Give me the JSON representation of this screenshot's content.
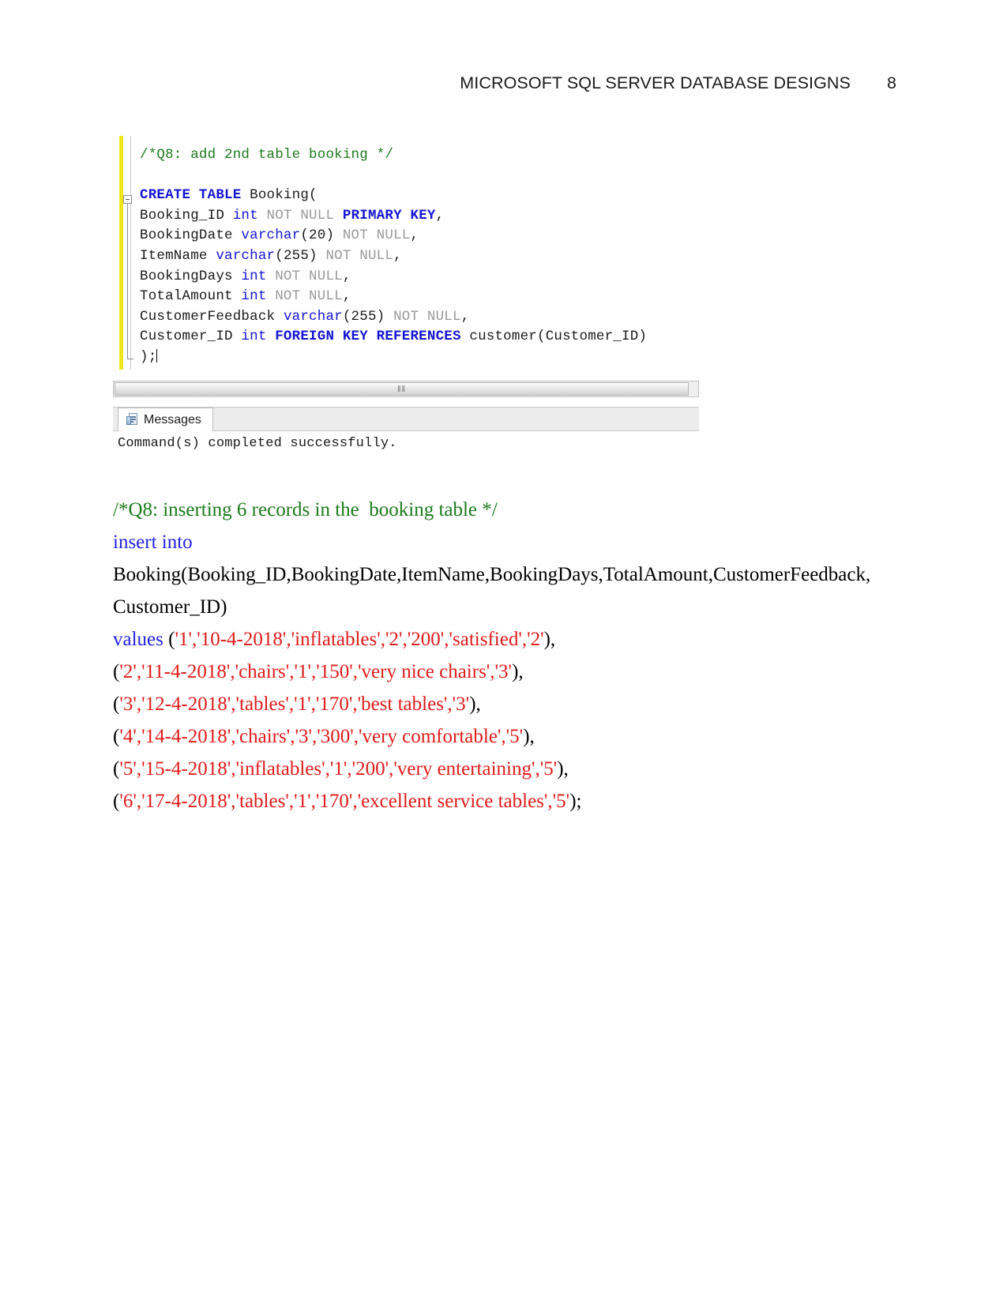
{
  "header": {
    "title": "MICROSOFT SQL SERVER DATABASE DESIGNS",
    "page_number": "8"
  },
  "ssms": {
    "editor": {
      "lines": [
        {
          "id": "l1",
          "segments": [
            {
              "text": "/*Q8: add 2nd table booking */",
              "style": "cmt"
            }
          ]
        },
        {
          "id": "l2",
          "segments": [
            {
              "text": "",
              "style": "pln"
            }
          ]
        },
        {
          "id": "l3",
          "segments": [
            {
              "text": "CREATE TABLE ",
              "style": "kw"
            },
            {
              "text": "Booking(",
              "style": "pln"
            }
          ]
        },
        {
          "id": "l4",
          "segments": [
            {
              "text": "Booking_ID ",
              "style": "pln"
            },
            {
              "text": "int ",
              "style": "typ"
            },
            {
              "text": "NOT NULL ",
              "style": "dim"
            },
            {
              "text": "PRIMARY KEY",
              "style": "kw"
            },
            {
              "text": ",",
              "style": "pln"
            }
          ]
        },
        {
          "id": "l5",
          "segments": [
            {
              "text": "BookingDate ",
              "style": "pln"
            },
            {
              "text": "varchar",
              "style": "typ"
            },
            {
              "text": "(20) ",
              "style": "pln"
            },
            {
              "text": "NOT NULL",
              "style": "dim"
            },
            {
              "text": ",",
              "style": "pln"
            }
          ]
        },
        {
          "id": "l6",
          "segments": [
            {
              "text": "ItemName ",
              "style": "pln"
            },
            {
              "text": "varchar",
              "style": "typ"
            },
            {
              "text": "(255) ",
              "style": "pln"
            },
            {
              "text": "NOT NULL",
              "style": "dim"
            },
            {
              "text": ",",
              "style": "pln"
            }
          ]
        },
        {
          "id": "l7",
          "segments": [
            {
              "text": "BookingDays ",
              "style": "pln"
            },
            {
              "text": "int ",
              "style": "typ"
            },
            {
              "text": "NOT NULL",
              "style": "dim"
            },
            {
              "text": ",",
              "style": "pln"
            }
          ]
        },
        {
          "id": "l8",
          "segments": [
            {
              "text": "TotalAmount ",
              "style": "pln"
            },
            {
              "text": "int ",
              "style": "typ"
            },
            {
              "text": "NOT NULL",
              "style": "dim"
            },
            {
              "text": ",",
              "style": "pln"
            }
          ]
        },
        {
          "id": "l9",
          "segments": [
            {
              "text": "CustomerFeedback ",
              "style": "pln"
            },
            {
              "text": "varchar",
              "style": "typ"
            },
            {
              "text": "(255) ",
              "style": "pln"
            },
            {
              "text": "NOT NULL",
              "style": "dim"
            },
            {
              "text": ",",
              "style": "pln"
            }
          ]
        },
        {
          "id": "l10",
          "segments": [
            {
              "text": "Customer_ID ",
              "style": "pln"
            },
            {
              "text": "int ",
              "style": "typ"
            },
            {
              "text": "FOREIGN KEY REFERENCES ",
              "style": "kw"
            },
            {
              "text": "customer(Customer_ID)",
              "style": "pln"
            }
          ]
        },
        {
          "id": "l11",
          "segments": [
            {
              "text": ");",
              "style": "pln"
            }
          ],
          "caret": true
        }
      ]
    },
    "scrollbar": {
      "grip": "‖‖"
    },
    "results_tab": {
      "icon": "messages-icon",
      "label": "Messages"
    },
    "results_message": "Command(s) completed successfully."
  },
  "document": {
    "lines": [
      {
        "id": "d1",
        "parts": [
          {
            "text": "/*Q8: inserting 6 records in the  booking table */",
            "color": "t-green"
          }
        ]
      },
      {
        "id": "d2",
        "parts": [
          {
            "text": "insert into",
            "color": "t-blue"
          }
        ]
      },
      {
        "id": "d3",
        "parts": [
          {
            "text": "Booking(Booking_ID,BookingDate,ItemName,BookingDays,TotalAmount,CustomerFeedback,",
            "color": "t-black"
          }
        ]
      },
      {
        "id": "d4",
        "parts": [
          {
            "text": "Customer_ID)",
            "color": "t-black"
          }
        ]
      },
      {
        "id": "d5",
        "parts": [
          {
            "text": "values ",
            "color": "t-blue"
          },
          {
            "text": "(",
            "color": "t-black"
          },
          {
            "text": "'1','10-4-2018','inflatables','2','200','satisfied','2'",
            "color": "t-red"
          },
          {
            "text": "),",
            "color": "t-black"
          }
        ]
      },
      {
        "id": "d6",
        "parts": [
          {
            "text": "(",
            "color": "t-black"
          },
          {
            "text": "'2','11-4-2018','chairs','1','150','very nice chairs','3'",
            "color": "t-red"
          },
          {
            "text": "),",
            "color": "t-black"
          }
        ]
      },
      {
        "id": "d7",
        "parts": [
          {
            "text": "(",
            "color": "t-black"
          },
          {
            "text": "'3','12-4-2018','tables','1','170','best tables','3'",
            "color": "t-red"
          },
          {
            "text": "),",
            "color": "t-black"
          }
        ]
      },
      {
        "id": "d8",
        "parts": [
          {
            "text": "(",
            "color": "t-black"
          },
          {
            "text": "'4','14-4-2018','chairs','3','300','very comfortable','5'",
            "color": "t-red"
          },
          {
            "text": "),",
            "color": "t-black"
          }
        ]
      },
      {
        "id": "d9",
        "parts": [
          {
            "text": "(",
            "color": "t-black"
          },
          {
            "text": "'5','15-4-2018','inflatables','1','200','very entertaining','5'",
            "color": "t-red"
          },
          {
            "text": "),",
            "color": "t-black"
          }
        ]
      },
      {
        "id": "d10",
        "parts": [
          {
            "text": "(",
            "color": "t-black"
          },
          {
            "text": "'6','17-4-2018','tables','1','170','excellent service tables','5'",
            "color": "t-red"
          },
          {
            "text": ");",
            "color": "t-black"
          }
        ]
      }
    ]
  },
  "colors": {
    "comment_green": "#1f7a1f",
    "keyword_blue": "#1414d2",
    "literal_red": "#e01b1b",
    "gutter_yellow": "#f2e41a",
    "dim_gray": "#9a9a9a"
  }
}
